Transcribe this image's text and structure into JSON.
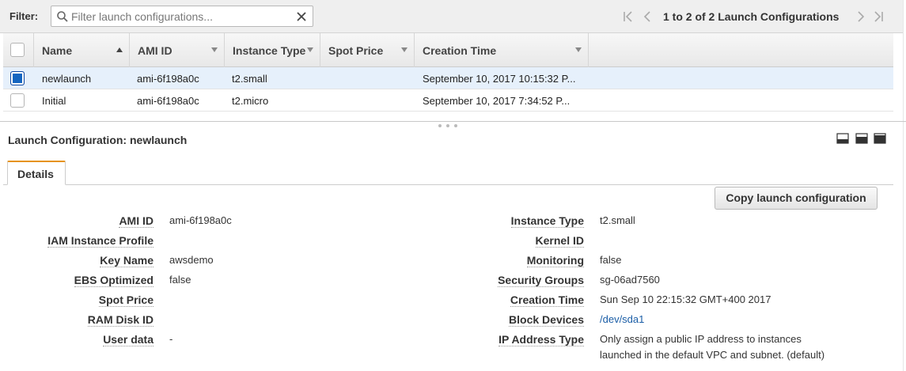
{
  "filter": {
    "label": "Filter:",
    "placeholder": "Filter launch configurations..."
  },
  "pager": {
    "text": "1 to 2 of 2 Launch Configurations"
  },
  "table": {
    "columns": [
      "Name",
      "AMI ID",
      "Instance Type",
      "Spot Price",
      "Creation Time"
    ],
    "rows": [
      {
        "selected": true,
        "name": "newlaunch",
        "ami": "ami-6f198a0c",
        "type": "t2.small",
        "spot": "",
        "created": "September 10, 2017 10:15:32 P..."
      },
      {
        "selected": false,
        "name": "Initial",
        "ami": "ami-6f198a0c",
        "type": "t2.micro",
        "spot": "",
        "created": "September 10, 2017 7:34:52 P..."
      }
    ]
  },
  "detail": {
    "title": "Launch Configuration: newlaunch",
    "tab": "Details",
    "copy_button": "Copy launch configuration",
    "left": [
      {
        "label": "AMI ID",
        "value": "ami-6f198a0c"
      },
      {
        "label": "IAM Instance Profile",
        "value": ""
      },
      {
        "label": "Key Name",
        "value": "awsdemo"
      },
      {
        "label": "EBS Optimized",
        "value": "false"
      },
      {
        "label": "Spot Price",
        "value": ""
      },
      {
        "label": "RAM Disk ID",
        "value": ""
      },
      {
        "label": "User data",
        "value": "-"
      }
    ],
    "right": [
      {
        "label": "Instance Type",
        "value": "t2.small"
      },
      {
        "label": "Kernel ID",
        "value": ""
      },
      {
        "label": "Monitoring",
        "value": "false"
      },
      {
        "label": "Security Groups",
        "value": "sg-06ad7560"
      },
      {
        "label": "Creation Time",
        "value": "Sun Sep 10 22:15:32 GMT+400 2017"
      },
      {
        "label": "Block Devices",
        "value": "/dev/sda1"
      },
      {
        "label": "IP Address Type",
        "value": "Only assign a public IP address to instances",
        "value2": "launched in the default VPC and subnet. (default)"
      }
    ]
  },
  "colors": {
    "accent_tab": "#e69317",
    "selected_row": "#e6f0fb",
    "checkbox_on": "#1565c0",
    "link": "#1a5da6"
  }
}
